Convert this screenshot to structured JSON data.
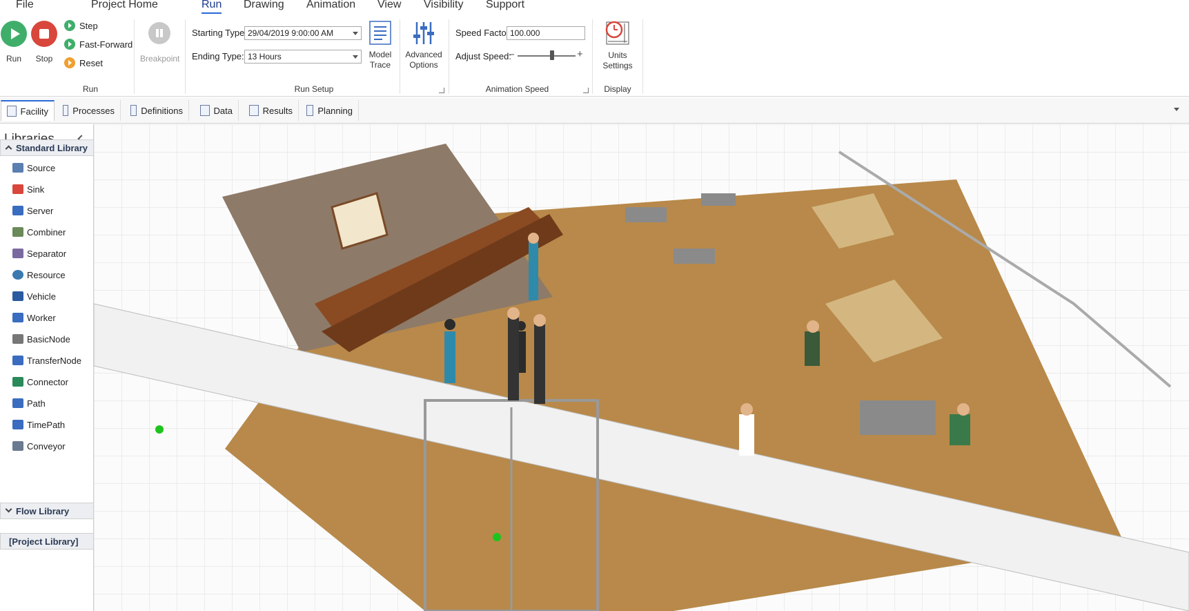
{
  "menu": [
    "File",
    "Project Home",
    "Run",
    "Drawing",
    "Animation",
    "View",
    "Visibility",
    "Support"
  ],
  "ribbon": {
    "run_group": {
      "run_label": "Run",
      "stop_label": "Stop",
      "step_label": "Step",
      "fast_forward_label": "Fast-Forward",
      "reset_label": "Reset",
      "breakpoint_label": "Breakpoint",
      "group_label": "Run"
    },
    "run_setup": {
      "starting_type_label": "Starting Type:",
      "starting_type_value": "29/04/2019 9:00:00 AM",
      "ending_type_label": "Ending Type:",
      "ending_type_value": "13 Hours",
      "model_trace_label": "Model Trace",
      "advanced_options_label": "Advanced Options",
      "group_label": "Run Setup"
    },
    "animation_speed": {
      "speed_factor_label": "Speed Factor:",
      "speed_factor_value": "100.000",
      "adjust_speed_label": "Adjust Speed:",
      "speed_level": 0.6,
      "group_label": "Animation Speed"
    },
    "display": {
      "units_settings_label": "Units Settings",
      "group_label": "Display"
    }
  },
  "tabs": [
    "Facility",
    "Processes",
    "Definitions",
    "Data",
    "Results",
    "Planning"
  ],
  "active_tab": "Facility",
  "libraries": {
    "title": "Libraries",
    "standard_library_label": "Standard Library",
    "standard_items": [
      "Source",
      "Sink",
      "Server",
      "Combiner",
      "Separator",
      "Resource",
      "Vehicle",
      "Worker",
      "BasicNode",
      "TransferNode",
      "Connector",
      "Path",
      "TimePath",
      "Conveyor"
    ],
    "flow_library_label": "Flow Library",
    "project_library_label": "[Project Library]"
  },
  "colors": {
    "accent": "#2a6ad8",
    "run_green": "#3fae6a",
    "stop_red": "#d9463b",
    "floor": "#b8894a",
    "grid": "#d8d8d8"
  }
}
